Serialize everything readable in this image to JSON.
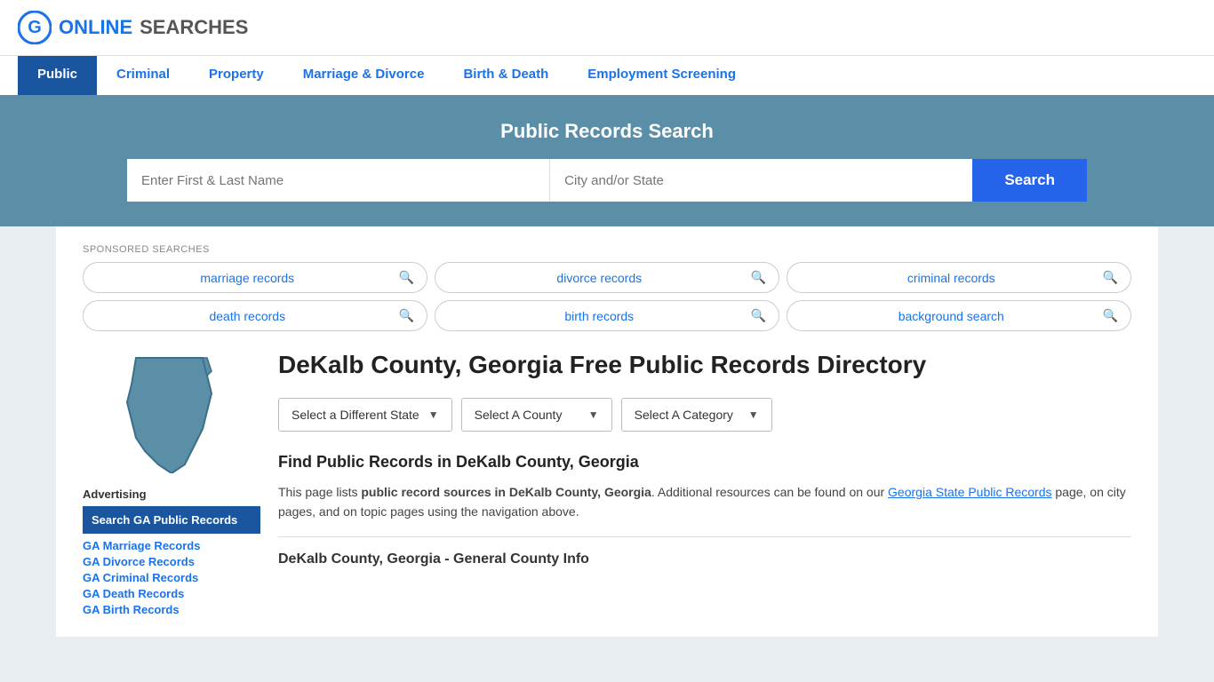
{
  "header": {
    "logo_online": "ONLINE",
    "logo_searches": "SEARCHES"
  },
  "nav": {
    "items": [
      {
        "label": "Public",
        "active": true
      },
      {
        "label": "Criminal",
        "active": false
      },
      {
        "label": "Property",
        "active": false
      },
      {
        "label": "Marriage & Divorce",
        "active": false
      },
      {
        "label": "Birth & Death",
        "active": false
      },
      {
        "label": "Employment Screening",
        "active": false
      }
    ]
  },
  "search_banner": {
    "title": "Public Records Search",
    "name_placeholder": "Enter First & Last Name",
    "location_placeholder": "City and/or State",
    "button_label": "Search"
  },
  "sponsored": {
    "label": "SPONSORED SEARCHES",
    "items": [
      {
        "label": "marriage records"
      },
      {
        "label": "divorce records"
      },
      {
        "label": "criminal records"
      },
      {
        "label": "death records"
      },
      {
        "label": "birth records"
      },
      {
        "label": "background search"
      }
    ]
  },
  "dropdowns": {
    "state": "Select a Different State",
    "county": "Select A County",
    "category": "Select A Category"
  },
  "page_title": "DeKalb County, Georgia Free Public Records Directory",
  "find_records": {
    "section_title": "Find Public Records in DeKalb County, Georgia",
    "description_start": "This page lists ",
    "description_bold": "public record sources in DeKalb County, Georgia",
    "description_mid": ". Additional resources can be found on our ",
    "link_text": "Georgia State Public Records",
    "description_end": " page, on city pages, and on topic pages using the navigation above."
  },
  "county_general": {
    "title": "DeKalb County, Georgia - General County Info"
  },
  "sidebar": {
    "advertising_label": "Advertising",
    "ad_active_label": "Search GA Public Records",
    "links": [
      "GA Marriage Records",
      "GA Divorce Records",
      "GA Criminal Records",
      "GA Death Records",
      "GA Birth Records"
    ]
  },
  "colors": {
    "banner_bg": "#5b8fa8",
    "nav_active": "#1a56a0",
    "link_color": "#1a73e8",
    "search_btn": "#2563eb"
  }
}
